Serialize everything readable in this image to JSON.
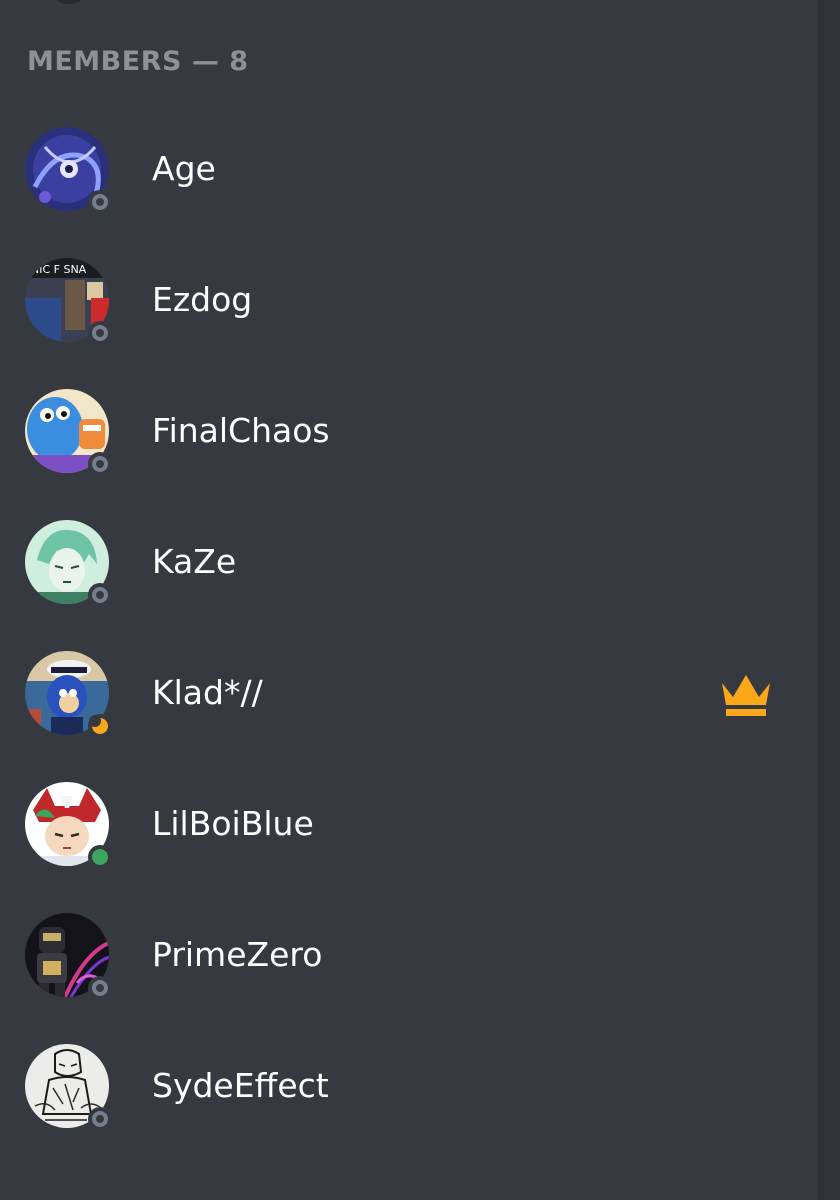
{
  "members_header": {
    "label": "MEMBERS — 8"
  },
  "colors": {
    "background": "#36393f",
    "header_text": "#8e9297",
    "name_text": "#ffffff",
    "status_offline": "#747f8d",
    "status_online": "#3ba55d",
    "status_idle": "#faa81a",
    "owner_crown": "#faa81a"
  },
  "members": [
    {
      "name": "Age",
      "status": "offline",
      "avatar": "galaxy-avatar",
      "owner": false
    },
    {
      "name": "Ezdog",
      "status": "offline",
      "avatar": "photo-avatar",
      "owner": false,
      "avatar_text": "NIC F SNA"
    },
    {
      "name": "FinalChaos",
      "status": "offline",
      "avatar": "cartoon-avatar",
      "owner": false
    },
    {
      "name": "KaZe",
      "status": "offline",
      "avatar": "anime-avatar",
      "owner": false
    },
    {
      "name": "Klad*//",
      "status": "idle",
      "avatar": "sonic-avatar",
      "owner": true,
      "owner_icon": "crown-icon"
    },
    {
      "name": "LilBoiBlue",
      "status": "online",
      "avatar": "anime-helmet-avatar",
      "owner": false
    },
    {
      "name": "PrimeZero",
      "status": "offline",
      "avatar": "robot-avatar",
      "owner": false
    },
    {
      "name": "SydeEffect",
      "status": "offline",
      "avatar": "sketch-avatar",
      "owner": false
    }
  ]
}
